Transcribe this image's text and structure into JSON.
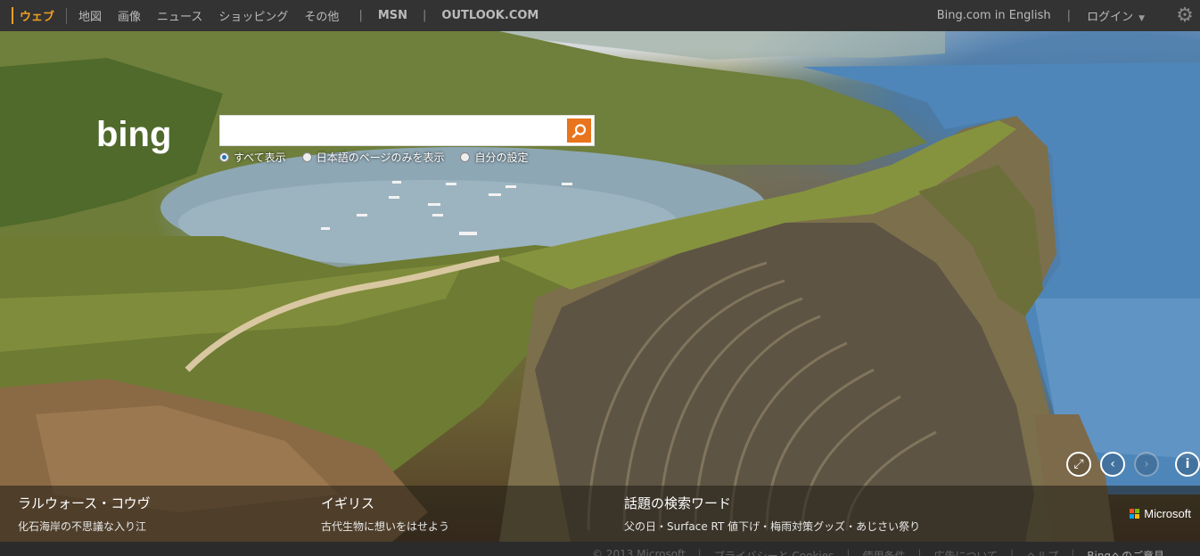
{
  "topbar": {
    "nav": [
      "ウェブ",
      "地図",
      "画像",
      "ニュース",
      "ショッピング",
      "その他"
    ],
    "links": [
      "MSN",
      "OUTLOOK.COM"
    ],
    "english": "Bing.com in English",
    "login": "ログイン"
  },
  "search": {
    "logo": "bing",
    "placeholder": "",
    "radios": [
      "すべて表示",
      "日本語のページのみを表示",
      "自分の設定"
    ]
  },
  "hero": {
    "blocks": [
      {
        "title": "ラルウォース・コウヴ",
        "sub": "化石海岸の不思議な入り江"
      },
      {
        "title": "イギリス",
        "sub": "古代生物に想いをはせよう"
      },
      {
        "title": "話題の検索ワード",
        "sub": "父の日・Surface RT 値下げ・梅雨対策グッズ・あじさい祭り"
      }
    ],
    "controls": {
      "info": "i"
    }
  },
  "microsoft": "Microsoft",
  "footer": [
    "© 2013 Microsoft",
    "プライバシーと Cookies",
    "使用条件",
    "広告について",
    "ヘルプ",
    "Bingへのご意見"
  ],
  "colors": {
    "accent": "#f0a020",
    "search_button": "#e8741d",
    "topbar": "#333333"
  }
}
